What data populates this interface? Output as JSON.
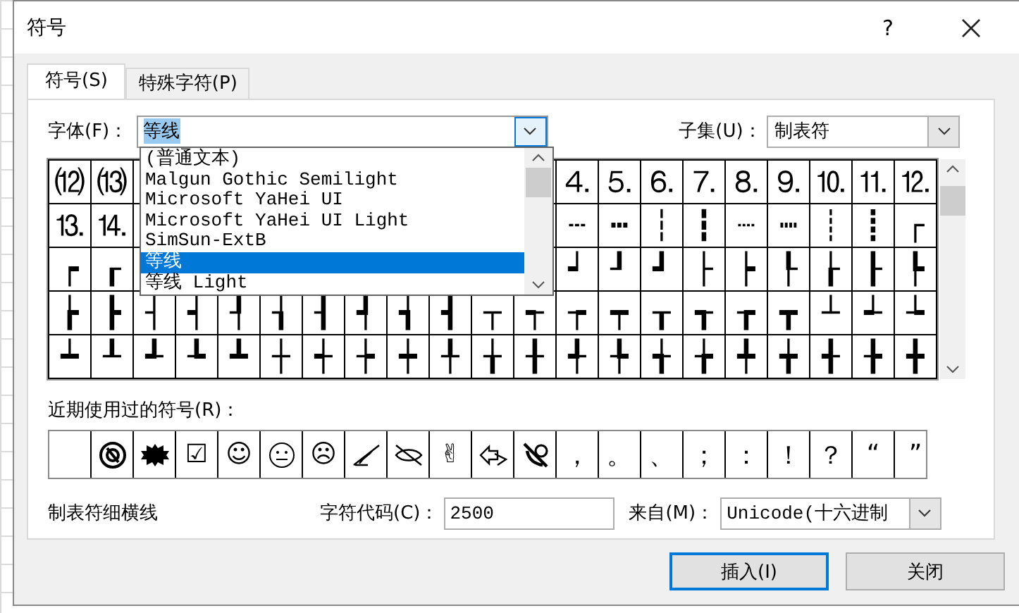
{
  "window": {
    "title": "符号",
    "help": "?"
  },
  "tabs": [
    {
      "label": "符号(S)",
      "selected": true
    },
    {
      "label": "特殊字符(P)",
      "selected": false
    }
  ],
  "font": {
    "label": "字体(F)：",
    "value": "等线"
  },
  "font_list": {
    "items": [
      {
        "label": "(普通文本)",
        "selected": false
      },
      {
        "label": "Malgun Gothic Semilight",
        "selected": false
      },
      {
        "label": "Microsoft YaHei UI",
        "selected": false
      },
      {
        "label": "Microsoft YaHei UI Light",
        "selected": false
      },
      {
        "label": "SimSun-ExtB",
        "selected": false
      },
      {
        "label": "等线",
        "selected": true
      },
      {
        "label": "等线 Light",
        "selected": false
      }
    ]
  },
  "subset": {
    "label": "子集(U)：",
    "value": "制表符"
  },
  "grid": {
    "rows": [
      [
        "⑿",
        "⒀",
        null,
        null,
        null,
        null,
        null,
        null,
        null,
        null,
        null,
        null,
        "⒋",
        "⒌",
        "⒍",
        "⒎",
        "⒏",
        "⒐",
        "⒑",
        "⒒",
        "⒓"
      ],
      [
        "⒔",
        "⒕",
        null,
        null,
        null,
        null,
        null,
        null,
        null,
        null,
        null,
        null,
        "┄",
        "┅",
        "┆",
        "┇",
        "┈",
        "┉",
        "┊",
        "┋",
        "┌"
      ],
      [
        "┍",
        "┎",
        null,
        null,
        null,
        null,
        null,
        null,
        null,
        null,
        null,
        null,
        "┙",
        "┚",
        "┛",
        "├",
        "┝",
        "┞",
        "┟",
        "┠",
        "┡"
      ],
      [
        "┢",
        "┣",
        "┤",
        "┥",
        "┦",
        "┧",
        "┨",
        "┩",
        "┪",
        "┫",
        "┬",
        "┭",
        "┮",
        "┯",
        "┰",
        "┱",
        "┲",
        "┳",
        "┴",
        "┵",
        "┶"
      ],
      [
        "┷",
        "┸",
        "┹",
        "┺",
        "┻",
        "┼",
        "┽",
        "┾",
        "┿",
        "╀",
        "╁",
        "╂",
        "╃",
        "╄",
        "╅",
        "╆",
        "╇",
        "╈",
        "╉",
        "╊",
        "╋"
      ]
    ]
  },
  "recent": {
    "label": "近期使用过的符号(R)：",
    "items": [
      {
        "kind": "badge"
      },
      {
        "kind": "burst"
      },
      {
        "kind": "char",
        "text": "☑"
      },
      {
        "kind": "char",
        "text": "☺"
      },
      {
        "kind": "neutral"
      },
      {
        "kind": "char",
        "text": "☹"
      },
      {
        "kind": "pen"
      },
      {
        "kind": "eye"
      },
      {
        "kind": "char",
        "text": "✌"
      },
      {
        "kind": "envelope"
      },
      {
        "kind": "phone"
      },
      {
        "kind": "char",
        "text": "，"
      },
      {
        "kind": "char",
        "text": "。"
      },
      {
        "kind": "char",
        "text": "、"
      },
      {
        "kind": "char",
        "text": "；"
      },
      {
        "kind": "char",
        "text": "："
      },
      {
        "kind": "char",
        "text": "！"
      },
      {
        "kind": "char",
        "text": "？"
      },
      {
        "kind": "char",
        "text": "“"
      },
      {
        "kind": "char",
        "text": "”"
      }
    ]
  },
  "char_name": "制表符细横线",
  "char_code": {
    "label": "字符代码(C)：",
    "value": "2500"
  },
  "from": {
    "label": "来自(M)：",
    "value": "Unicode(十六进制"
  },
  "buttons": [
    {
      "label": "插入(I)",
      "kind": "default"
    },
    {
      "label": "关闭",
      "kind": "normal"
    }
  ]
}
